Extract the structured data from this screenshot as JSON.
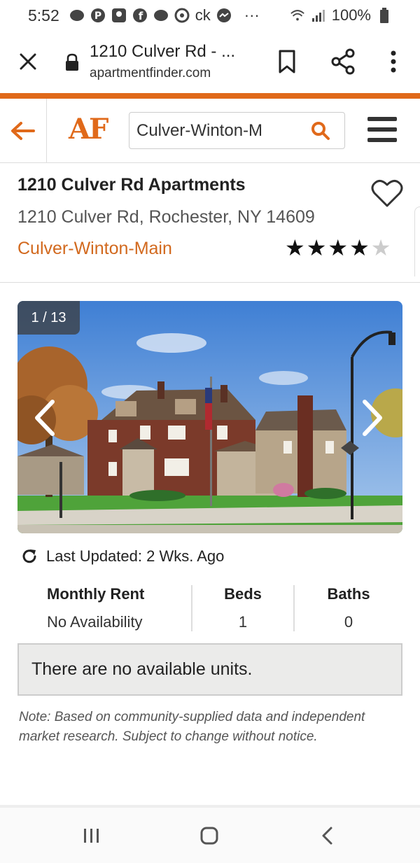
{
  "status_bar": {
    "time": "5:52",
    "carrier_text": "ck",
    "battery": "100%",
    "more": "···"
  },
  "browser": {
    "page_title": "1210 Culver Rd - ...",
    "domain": "apartmentfinder.com"
  },
  "site_header": {
    "logo": "AF",
    "search_value": "Culver-Winton-M",
    "accent_color": "#e0691a"
  },
  "listing": {
    "title": "1210 Culver Rd Apartments",
    "address": "1210 Culver Rd, Rochester, NY 14609",
    "neighborhood": "Culver-Winton-Main",
    "rating": 4,
    "rating_max": 5
  },
  "gallery": {
    "counter": "1 / 13"
  },
  "updated": {
    "text": "Last Updated: 2 Wks. Ago"
  },
  "stats": {
    "rent_label": "Monthly Rent",
    "rent_value": "No Availability",
    "beds_label": "Beds",
    "beds_value": "1",
    "baths_label": "Baths",
    "baths_value": "0"
  },
  "notice": {
    "text": "There are no available units."
  },
  "note": {
    "text": "Note: Based on community-supplied data and independent market research. Subject to change without notice."
  }
}
